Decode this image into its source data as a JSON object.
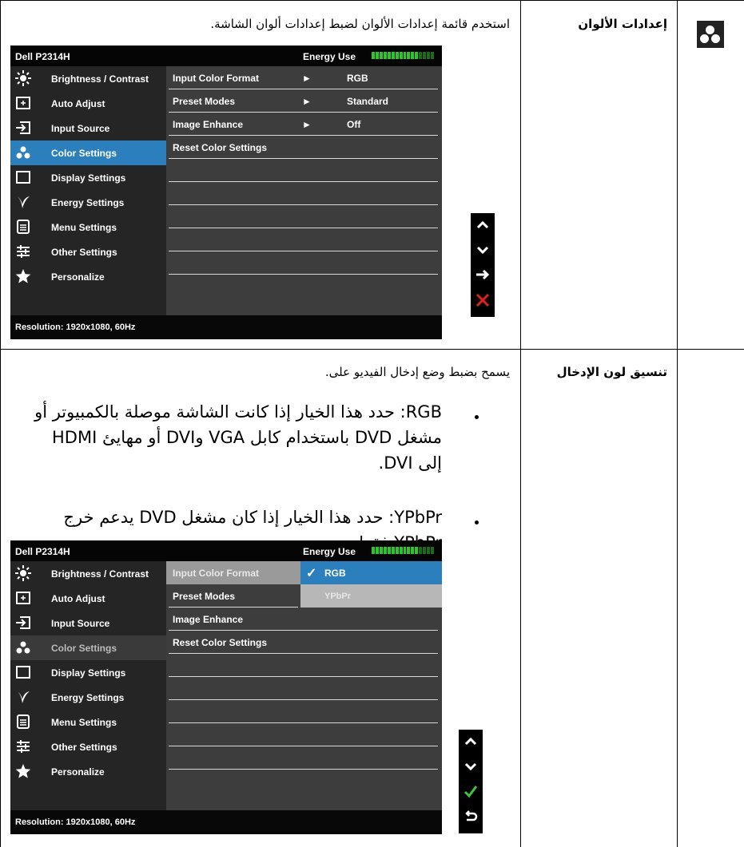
{
  "row1": {
    "label": "إعدادات الألوان",
    "description": "استخدم قائمة إعدادات الألوان لضبط إعدادات ألوان الشاشة.",
    "osd": {
      "title": "Dell P2314H",
      "energy_label": "Energy Use",
      "menu": [
        "Brightness / Contrast",
        "Auto Adjust",
        "Input Source",
        "Color Settings",
        "Display Settings",
        "Energy Settings",
        "Menu Settings",
        "Other Settings",
        "Personalize"
      ],
      "rows": [
        {
          "label": "Input Color Format",
          "arrow": "►",
          "value": "RGB"
        },
        {
          "label": "Preset Modes",
          "arrow": "►",
          "value": "Standard"
        },
        {
          "label": "Image Enhance",
          "arrow": "►",
          "value": "Off"
        },
        {
          "label": "Reset Color Settings",
          "arrow": "",
          "value": ""
        }
      ],
      "resolution": "Resolution: 1920x1080, 60Hz",
      "buttons": [
        "up",
        "down",
        "enter",
        "exit"
      ]
    }
  },
  "row2": {
    "label": "تنسيق لون الإدخال",
    "description": "يسمح بضبط وضع إدخال الفيديو على.",
    "bullets": [
      "RGB: حدد هذا الخيار إذا كانت الشاشة موصلة بالكمبيوتر أو مشغل DVD باستخدام كابل VGA وDVI أو مهايئ HDMI إلى DVI.",
      "YPbPr: حدد هذا الخيار إذا كان مشغل DVD يدعم خرج YPbPr فقط."
    ],
    "osd": {
      "title": "Dell P2314H",
      "energy_label": "Energy Use",
      "menu": [
        "Brightness / Contrast",
        "Auto Adjust",
        "Input Source",
        "Color Settings",
        "Display Settings",
        "Energy Settings",
        "Menu Settings",
        "Other Settings",
        "Personalize"
      ],
      "rows": [
        {
          "label": "Input Color Format"
        },
        {
          "label": "Preset Modes"
        },
        {
          "label": "Image Enhance"
        },
        {
          "label": "Reset Color Settings"
        }
      ],
      "options": [
        "RGB",
        "YPbPr"
      ],
      "resolution": "Resolution: 1920x1080, 60Hz"
    }
  }
}
